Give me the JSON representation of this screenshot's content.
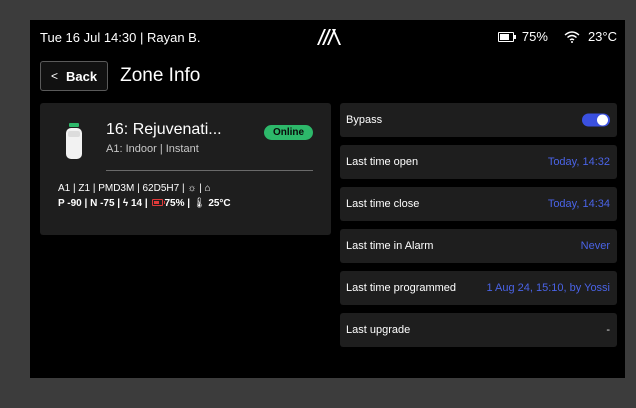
{
  "status_bar": {
    "datetime_user": "Tue 16 Jul 14:30 | Rayan B.",
    "battery": "75%",
    "temperature": "23°C"
  },
  "header": {
    "back_label": "Back",
    "title": "Zone Info"
  },
  "device": {
    "name": "16: Rejuvenati...",
    "status": "Online",
    "subtitle": "A1: Indoor  |  Instant",
    "line1": "A1 | Z1 | PMD3M | 62D5H7 | ",
    "line2_signal": "P -90 | N -75 | ",
    "line2_14": "14 | ",
    "line2_batt": "75% | ",
    "line2_temp": "25°C"
  },
  "details": [
    {
      "label": "Bypass",
      "type": "toggle",
      "enabled": true
    },
    {
      "label": "Last time open",
      "value": "Today, 14:32"
    },
    {
      "label": "Last time close",
      "value": "Today, 14:34"
    },
    {
      "label": "Last time in Alarm",
      "value": "Never"
    },
    {
      "label": "Last time programmed",
      "value": "1 Aug 24, 15:10, by Yossi"
    },
    {
      "label": "Last upgrade",
      "value": "-"
    }
  ],
  "colors": {
    "accent": "#4a63e6",
    "online": "#2db86a",
    "low_battery": "#e03a3a"
  },
  "icons": [
    "logo-icon",
    "battery-icon",
    "wifi-icon",
    "device-icon",
    "chevron-left-icon",
    "sensor-icon",
    "home-icon",
    "lightning-icon",
    "thermometer-icon"
  ]
}
